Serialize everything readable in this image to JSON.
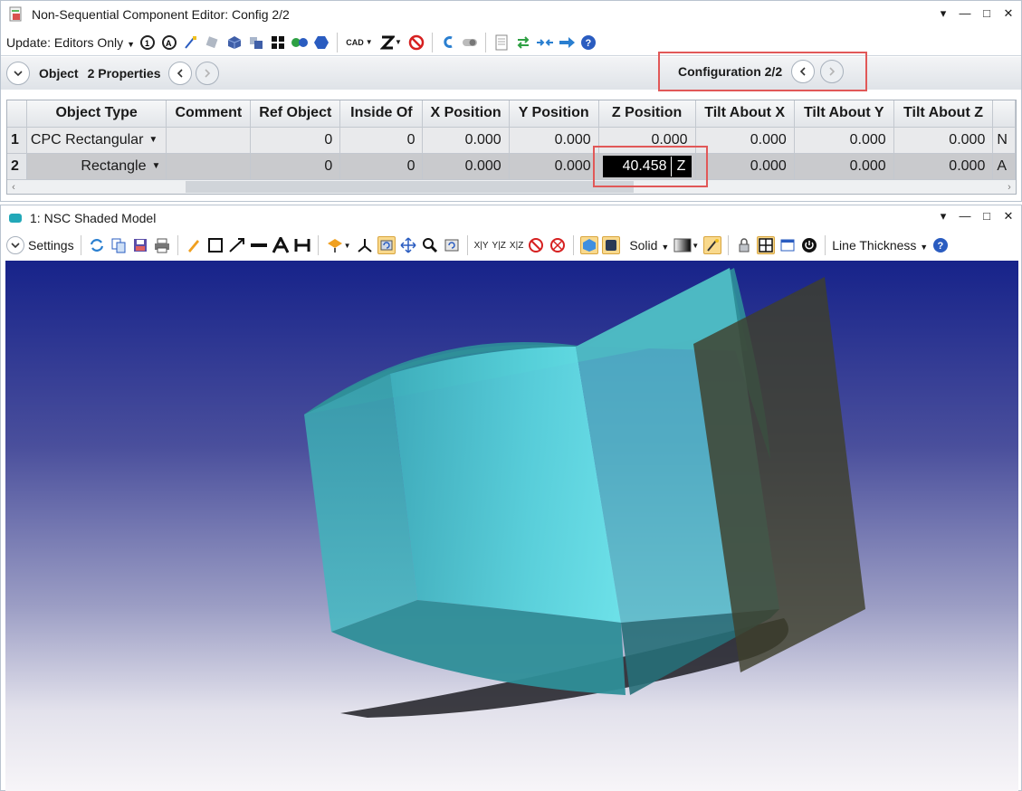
{
  "editor_window": {
    "title": "Non-Sequential Component Editor: Config 2/2",
    "controls": [
      "▾",
      "—",
      "□",
      "✕"
    ],
    "toolbar": {
      "update_label": "Update: Editors Only",
      "cad_label": "CAD"
    },
    "nav": {
      "object_label": "Object",
      "properties_label": "2 Properties",
      "configuration_label": "Configuration 2/2"
    },
    "table": {
      "columns": [
        "Object Type",
        "Comment",
        "Ref Object",
        "Inside Of",
        "X Position",
        "Y Position",
        "Z Position",
        "Tilt About X",
        "Tilt About Y",
        "Tilt About Z"
      ],
      "rows": [
        {
          "num": "1",
          "type": "CPC Rectangular",
          "comment": "",
          "ref": "0",
          "inside": "0",
          "x": "0.000",
          "y": "0.000",
          "z": "0.000",
          "tx": "0.000",
          "ty": "0.000",
          "tz": "0.000",
          "more": "N"
        },
        {
          "num": "2",
          "type": "Rectangle",
          "comment": "",
          "ref": "0",
          "inside": "0",
          "x": "0.000",
          "y": "0.000",
          "z": "40.458",
          "z_solve": "Z",
          "tx": "0.000",
          "ty": "0.000",
          "tz": "0.000",
          "more": "A"
        }
      ]
    }
  },
  "model_window": {
    "title": "1: NSC Shaded Model",
    "controls": [
      "▾",
      "—",
      "□",
      "✕"
    ],
    "toolbar": {
      "settings_label": "Settings",
      "axis_xy": "X|Y",
      "axis_yz": "Y|Z",
      "axis_xz": "X|Z",
      "solid_label": "Solid",
      "line_thickness_label": "Line Thickness"
    }
  },
  "colors": {
    "highlight": "#e15858",
    "cpc_body": "#4fc4d0",
    "rectangle_face": "#3e3f2c"
  }
}
